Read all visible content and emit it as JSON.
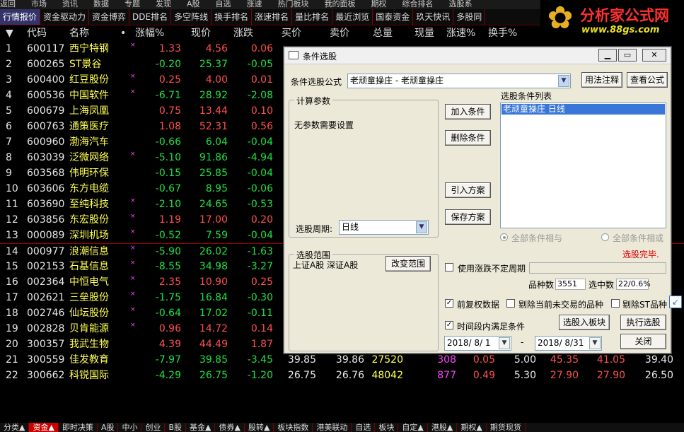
{
  "top_menu": [
    "返回",
    "市场",
    "资讯",
    "数据",
    "专题",
    "发现",
    "A股",
    "自选",
    "涨速",
    "热门板块",
    "我的面板",
    "期权",
    "综合排名",
    "选股系"
  ],
  "tabs": [
    {
      "label": "行情报价",
      "active": true
    },
    {
      "label": "资金驱动力"
    },
    {
      "label": "资金博弈"
    },
    {
      "label": "DDE排名"
    },
    {
      "label": "多空阵线"
    },
    {
      "label": "换手排名"
    },
    {
      "label": "涨速排名"
    },
    {
      "label": "量比排名"
    },
    {
      "label": "最近浏览"
    },
    {
      "label": "国泰资金"
    },
    {
      "label": "玖天快讯"
    },
    {
      "label": "多股同"
    }
  ],
  "logo": {
    "title": "分析家公式网",
    "url_text": "www.88gs.com"
  },
  "columns": {
    "arrow": "▼",
    "code": "代码",
    "name": "名称",
    "dot": "•",
    "pct": "涨幅%",
    "price": "现价",
    "chg": "涨跌",
    "bid": "买价",
    "ask": "卖价",
    "vol": "总量",
    "cur": "现量",
    "speed": "涨速%",
    "turn": "换手%"
  },
  "rows": [
    {
      "no": "1",
      "code": "600117",
      "name": "西宁特钢",
      "star": true,
      "pct": "1.33",
      "price": "4.56",
      "chg": "0.06",
      "dir": "up"
    },
    {
      "no": "2",
      "code": "600265",
      "name": "ST景谷",
      "star": false,
      "pct": "-0.20",
      "price": "25.37",
      "chg": "-0.05",
      "dir": "dn"
    },
    {
      "no": "3",
      "code": "600400",
      "name": "红豆股份",
      "star": true,
      "pct": "0.25",
      "price": "4.00",
      "chg": "0.01",
      "dir": "up"
    },
    {
      "no": "4",
      "code": "600536",
      "name": "中国软件",
      "star": true,
      "pct": "-6.71",
      "price": "28.92",
      "chg": "-2.08",
      "dir": "dn"
    },
    {
      "no": "5",
      "code": "600679",
      "name": "上海凤凰",
      "star": false,
      "pct": "0.75",
      "price": "13.44",
      "chg": "0.10",
      "dir": "up"
    },
    {
      "no": "6",
      "code": "600763",
      "name": "通策医疗",
      "star": false,
      "pct": "1.08",
      "price": "52.31",
      "chg": "0.56",
      "dir": "up"
    },
    {
      "no": "7",
      "code": "600960",
      "name": "渤海汽车",
      "star": false,
      "pct": "-0.66",
      "price": "6.04",
      "chg": "-0.04",
      "dir": "dn"
    },
    {
      "no": "8",
      "code": "603039",
      "name": "泛微网络",
      "star": true,
      "pct": "-5.10",
      "price": "91.86",
      "chg": "-4.94",
      "dir": "dn"
    },
    {
      "no": "9",
      "code": "603568",
      "name": "伟明环保",
      "star": false,
      "pct": "-0.15",
      "price": "25.85",
      "chg": "-0.04",
      "dir": "dn"
    },
    {
      "no": "10",
      "code": "603606",
      "name": "东方电缆",
      "star": false,
      "pct": "-0.67",
      "price": "8.95",
      "chg": "-0.06",
      "dir": "dn"
    },
    {
      "no": "11",
      "code": "603690",
      "name": "至纯科技",
      "star": true,
      "pct": "-2.10",
      "price": "24.65",
      "chg": "-0.53",
      "dir": "dn"
    },
    {
      "no": "12",
      "code": "603856",
      "name": "东宏股份",
      "star": true,
      "pct": "1.19",
      "price": "17.00",
      "chg": "0.20",
      "dir": "up"
    },
    {
      "no": "13",
      "code": "000089",
      "name": "深圳机场",
      "star": true,
      "pct": "-0.52",
      "price": "7.59",
      "chg": "-0.04",
      "dir": "dn"
    },
    {
      "no": "14",
      "code": "000977",
      "name": "浪潮信息",
      "star": true,
      "pct": "-5.90",
      "price": "26.02",
      "chg": "-1.63",
      "dir": "dn"
    },
    {
      "no": "15",
      "code": "002153",
      "name": "石基信息",
      "star": true,
      "pct": "-8.55",
      "price": "34.98",
      "chg": "-3.27",
      "dir": "dn"
    },
    {
      "no": "16",
      "code": "002364",
      "name": "中恒电气",
      "star": true,
      "pct": "2.35",
      "price": "10.90",
      "chg": "0.25",
      "dir": "up"
    },
    {
      "no": "17",
      "code": "002621",
      "name": "三垒股份",
      "star": true,
      "pct": "-1.75",
      "price": "16.84",
      "chg": "-0.30",
      "dir": "dn"
    },
    {
      "no": "18",
      "code": "002746",
      "name": "仙坛股份",
      "star": true,
      "pct": "-0.64",
      "price": "17.02",
      "chg": "-0.11",
      "dir": "dn"
    },
    {
      "no": "19",
      "code": "002828",
      "name": "贝肯能源",
      "star": true,
      "pct": "0.96",
      "price": "14.72",
      "chg": "0.14",
      "dir": "up"
    },
    {
      "no": "20",
      "code": "300357",
      "name": "我武生物",
      "star": false,
      "pct": "4.39",
      "price": "44.49",
      "chg": "1.87",
      "dir": "up"
    },
    {
      "no": "21",
      "code": "300559",
      "name": "佳发教育",
      "star": false,
      "pct": "-7.97",
      "price": "39.85",
      "chg": "-3.45",
      "dir": "dn",
      "bid": "39.85",
      "ask": "39.86",
      "vol": "27520",
      "cur": "308",
      "speed": "0.05",
      "turn": "5.00",
      "x1": "45.35",
      "x2": "41.05",
      "x3": "39.40"
    },
    {
      "no": "22",
      "code": "300662",
      "name": "科锐国际",
      "star": false,
      "pct": "-4.29",
      "price": "26.75",
      "chg": "-1.20",
      "dir": "dn",
      "bid": "26.75",
      "ask": "26.76",
      "vol": "48042",
      "cur": "877",
      "speed": "0.49",
      "turn": "5.30",
      "x1": "27.90",
      "x2": "27.90",
      "x3": "26.50"
    }
  ],
  "bottom_tabs": [
    {
      "label": "分类▲"
    },
    {
      "label": "资金▲",
      "active": true
    },
    {
      "label": "即时决策"
    },
    {
      "label": "A股"
    },
    {
      "label": "中小"
    },
    {
      "label": "创业"
    },
    {
      "label": "B股"
    },
    {
      "label": "基金▲"
    },
    {
      "label": "债券▲"
    },
    {
      "label": "股转▲"
    },
    {
      "label": "板块指数"
    },
    {
      "label": "港美联动"
    },
    {
      "label": "自选"
    },
    {
      "label": "板块"
    },
    {
      "label": "自定▲"
    },
    {
      "label": "港股▲"
    },
    {
      "label": "期权▲"
    },
    {
      "label": "期货现货"
    }
  ],
  "dialog": {
    "title": "条件选股",
    "formula_label": "条件选股公式",
    "formula_value": "老顽童操庄    - 老顽童操庄",
    "btn_usage": "用法注释",
    "btn_view": "查看公式",
    "calc_params": "计算参数",
    "no_params": "无参数需要设置",
    "btn_add": "加入条件",
    "btn_delete": "删除条件",
    "btn_import": "引入方案",
    "btn_save": "保存方案",
    "list_label": "选股条件列表",
    "list_items": [
      "老顽童操庄   日线"
    ],
    "period_label": "选股周期:",
    "period_value": "日线",
    "all_and": "全部条件相与",
    "all_or": "全部条件相或",
    "status": "选股完毕.",
    "range_label": "选股范围",
    "range_value": "上证A股  深证A股",
    "btn_change_range": "改变范围",
    "use_uncertain": "使用涨跌不定周期",
    "count_label": "品种数",
    "count_value": "3551",
    "selected_label": "选中数",
    "selected_value": "22/0.6%",
    "pre_adjust": "前复权数据",
    "exclude_untraded": "剔除当前未交易的品种",
    "exclude_st": "剔除ST品种",
    "period_satisfy": "时间段内满足条件",
    "btn_to_block": "选股入板块",
    "btn_execute": "执行选股",
    "date_from": "2018/ 8/ 1",
    "date_sep": "-",
    "date_to": "2018/ 8/31",
    "btn_close": "关闭"
  }
}
